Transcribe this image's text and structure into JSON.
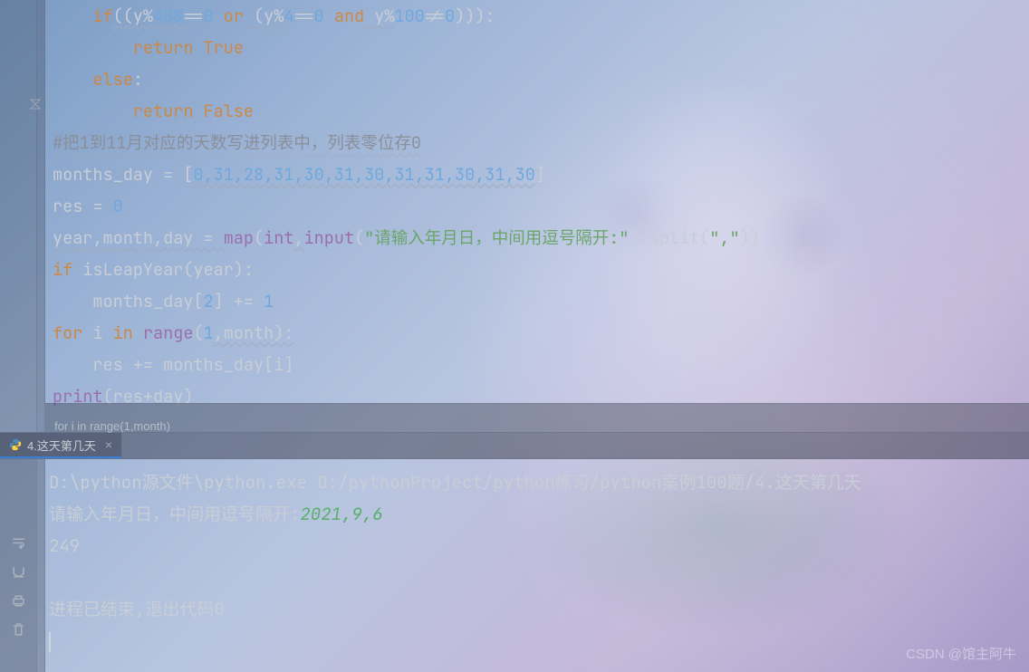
{
  "code": {
    "l1_if": "if",
    "l1_a": "((y%",
    "l1_400": "400",
    "l1_eq": "==",
    "l1_0a": "0",
    "l1_or": "or",
    "l1_b": " (y%",
    "l1_4": "4",
    "l1_0b": "0",
    "l1_and": "and",
    "l1_c": " y%",
    "l1_100": "100",
    "l1_ne": "!=",
    "l1_0c": "0",
    "l1_d": "))):",
    "l2_ret": "return",
    "l2_true": "True",
    "l3_else": "else",
    "l3_colon": ":",
    "l4_ret": "return",
    "l4_false": "False",
    "l5_comment": "#把1到11月对应的天数写进列表中，列表零位存0",
    "l6_a": "months_day = [",
    "l6_list": "0,31,28,31,30,31,30,31,31,30,31,30",
    "l6_b": "]",
    "l7_a": "res = ",
    "l7_0": "0",
    "l8_a": "year,month,day = ",
    "l8_map": "map",
    "l8_b": "(",
    "l8_int": "int",
    "l8_c": ",",
    "l8_input": "input",
    "l8_d": "(",
    "l8_str": "\"请输入年月日，中间用逗号隔开:\"",
    "l8_e": ").split(",
    "l8_str2": "\",\"",
    "l8_f": "))",
    "l9_if": "if",
    "l9_a": " isLeapYear(year):",
    "l10_a": "    months_day[",
    "l10_2": "2",
    "l10_b": "] += ",
    "l10_1": "1",
    "l11_for": "for",
    "l11_a": " i ",
    "l11_in": "in",
    "l11_range": "range",
    "l11_b": "(",
    "l11_1": "1",
    "l11_c": ",month):",
    "l12_a": "    res += months_day[i]",
    "l13_print": "print",
    "l13_a": "(res+day)"
  },
  "breadcrumb": "for i in range(1,month)",
  "tab": {
    "label": "4.这天第几天",
    "close": "×"
  },
  "console": {
    "cmd": "D:\\python源文件\\python.exe D:/pythonProject/python练习/python案例100题/4.这天第几天",
    "prompt": "请输入年月日，中间用逗号隔开:",
    "input": "2021,9,6",
    "result": "249",
    "exit": "进程已结束,退出代码0"
  },
  "watermark": "CSDN @馆主阿牛"
}
